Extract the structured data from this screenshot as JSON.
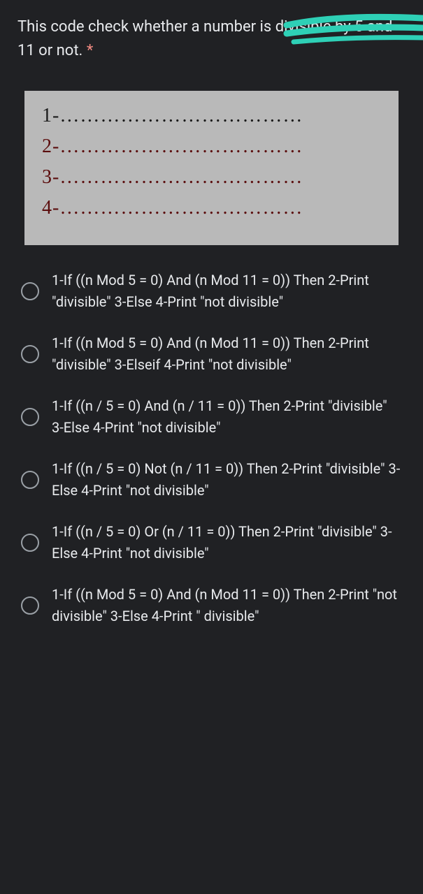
{
  "question": {
    "text": "This code check whether a number is divisible by 5 and 11 or not.",
    "required_marker": "*"
  },
  "code_blanks": {
    "line1": "1-………………………………",
    "line2": "2-………………………………",
    "line3": "3-………………………………",
    "line4": "4-………………………………"
  },
  "options": [
    {
      "text": "1-If ((n Mod 5 = 0) And (n Mod 11 = 0)) Then 2-Print \"divisible\" 3-Else 4-Print \"not divisible\""
    },
    {
      "text": "1-If ((n Mod 5 = 0) And (n Mod 11 = 0)) Then 2-Print \"divisible\" 3-Elseif 4-Print \"not divisible\""
    },
    {
      "text": "1-If ((n / 5 = 0) And (n / 11 = 0)) Then 2-Print \"divisible\" 3-Else 4-Print \"not divisible\""
    },
    {
      "text": "1-If ((n / 5 = 0) Not (n / 11 = 0)) Then 2-Print \"divisible\" 3-Else 4-Print \"not divisible\""
    },
    {
      "text": "1-If ((n / 5 = 0) Or (n / 11 = 0)) Then 2-Print \"divisible\" 3-Else 4-Print \"not divisible\""
    },
    {
      "text": "1-If ((n Mod 5 = 0) And (n Mod 11 = 0)) Then 2-Print \"not divisible\" 3-Else 4-Print \" divisible\""
    }
  ]
}
